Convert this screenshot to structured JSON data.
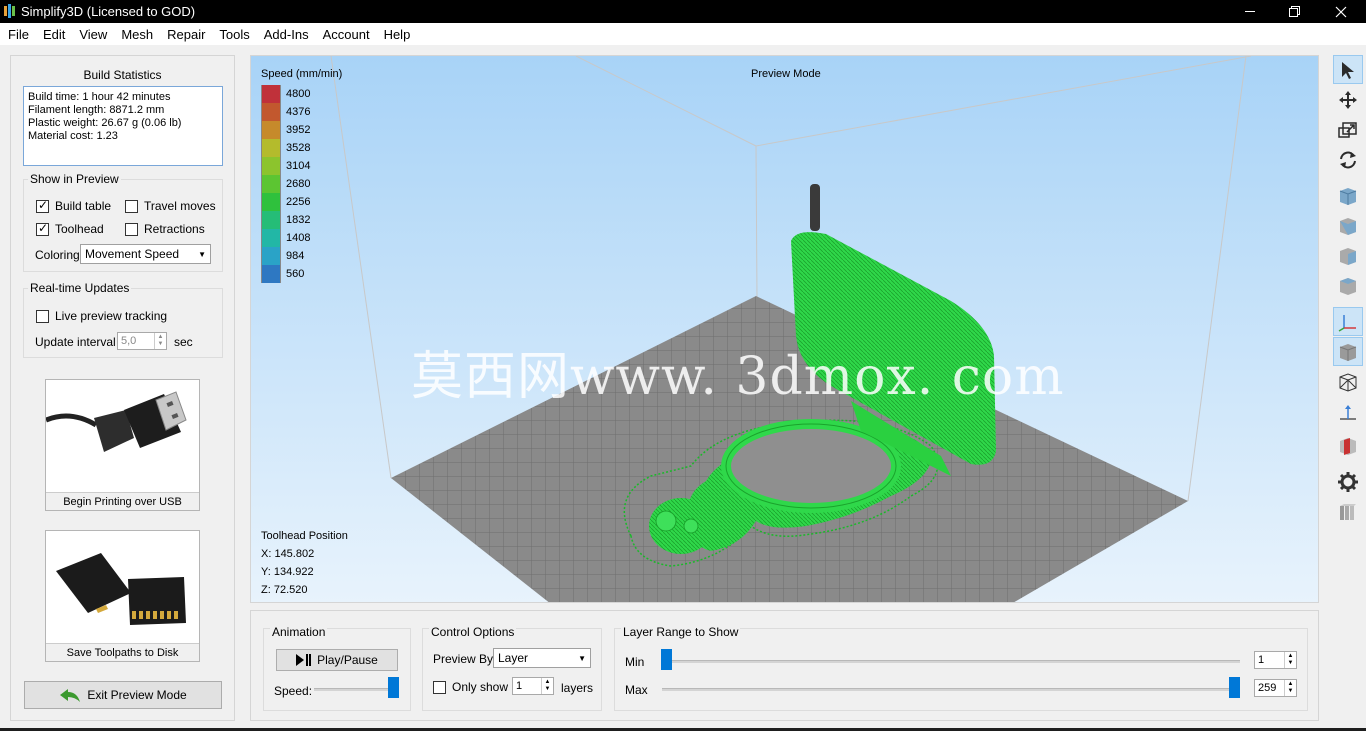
{
  "window": {
    "title": "Simplify3D (Licensed to GOD)",
    "controls": [
      "minimize",
      "restore",
      "close"
    ]
  },
  "menu": [
    "File",
    "Edit",
    "View",
    "Mesh",
    "Repair",
    "Tools",
    "Add-Ins",
    "Account",
    "Help"
  ],
  "left_panel": {
    "build_stats_title": "Build Statistics",
    "stats": [
      "Build time: 1 hour 42 minutes",
      "Filament length: 8871.2 mm",
      "Plastic weight: 26.67 g (0.06 lb)",
      "Material cost: 1.23"
    ],
    "show_in_preview": {
      "title": "Show in Preview",
      "build_table": {
        "label": "Build table",
        "checked": true
      },
      "travel_moves": {
        "label": "Travel moves",
        "checked": false
      },
      "toolhead": {
        "label": "Toolhead",
        "checked": true
      },
      "retractions": {
        "label": "Retractions",
        "checked": false
      },
      "coloring_label": "Coloring",
      "coloring_value": "Movement Speed"
    },
    "realtime": {
      "title": "Real-time Updates",
      "live_tracking": {
        "label": "Live preview tracking",
        "checked": false
      },
      "interval_label": "Update interval",
      "interval_value": "5,0",
      "interval_unit": "sec"
    },
    "usb_button": "Begin Printing over USB",
    "disk_button": "Save Toolpaths to Disk",
    "exit_button": "Exit Preview Mode"
  },
  "viewport": {
    "legend_title": "Speed (mm/min)",
    "legend": [
      {
        "value": "4800",
        "color": "#c0313a"
      },
      {
        "value": "4376",
        "color": "#c2582e"
      },
      {
        "value": "3952",
        "color": "#c68a2b"
      },
      {
        "value": "3528",
        "color": "#b4bb2c"
      },
      {
        "value": "3104",
        "color": "#8cc42d"
      },
      {
        "value": "2680",
        "color": "#5cc532"
      },
      {
        "value": "2256",
        "color": "#2fc13d"
      },
      {
        "value": "1832",
        "color": "#25bd77"
      },
      {
        "value": "1408",
        "color": "#22b7a6"
      },
      {
        "value": "984",
        "color": "#2aa3c7"
      },
      {
        "value": "560",
        "color": "#2e78c2"
      }
    ],
    "mode_label": "Preview Mode",
    "toolhead_title": "Toolhead Position",
    "x": "X: 145.802",
    "y": "Y: 134.922",
    "z": "Z: 72.520",
    "watermark": "莫西网www. 3dmox. com"
  },
  "bottom": {
    "animation_title": "Animation",
    "play_label": "Play/Pause",
    "speed_label": "Speed:",
    "speed_fraction": 1.0,
    "control_title": "Control Options",
    "preview_by_label": "Preview By",
    "preview_by_value": "Layer",
    "only_show_label": "Only show",
    "only_show_checked": false,
    "only_show_value": "1",
    "layers_label": "layers",
    "layer_range_title": "Layer Range to Show",
    "min_label": "Min",
    "max_label": "Max",
    "min_value": "1",
    "max_value": "259"
  },
  "right_toolbar": [
    "select-icon",
    "move-icon",
    "scale-icon",
    "rotate-icon",
    "view-default-icon",
    "view-front-icon",
    "view-side-icon",
    "view-top-icon",
    "axes-icon",
    "solid-view-icon",
    "wireframe-view-icon",
    "normals-icon",
    "cross-section-icon",
    "settings-gear-icon",
    "extrusion-icon"
  ]
}
